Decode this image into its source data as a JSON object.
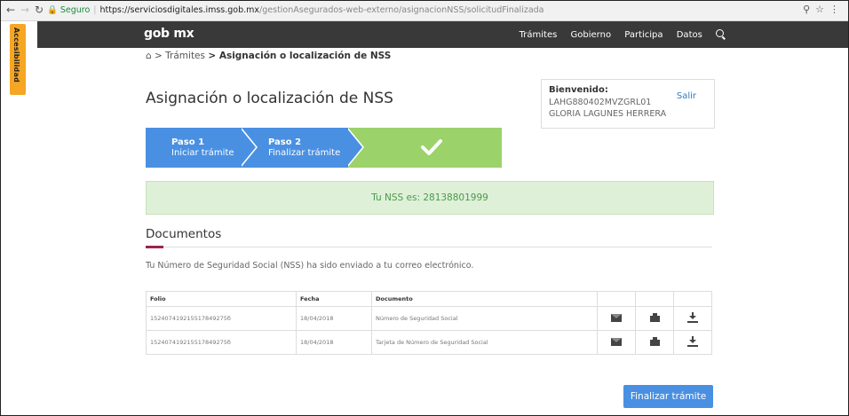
{
  "browser": {
    "secure_label": "Seguro",
    "url_host": "https://serviciosdigitales.imss.gob.mx",
    "url_path": "/gestionAsegurados-web-externo/asignacionNSS/solicitudFinalizada"
  },
  "accessibility": {
    "label": "Accesibilidad"
  },
  "header": {
    "logo": "gob mx",
    "nav": [
      "Trámites",
      "Gobierno",
      "Participa",
      "Datos"
    ]
  },
  "breadcrumb": {
    "separator": ">",
    "parent": "Trámites",
    "current": "Asignación o localización de NSS"
  },
  "page": {
    "title": "Asignación o localización de NSS"
  },
  "welcome": {
    "title": "Bienvenido:",
    "curp": "LAHG880402MVZGRL01",
    "name": "GLORIA LAGUNES HERRERA",
    "logout": "Salir"
  },
  "steps": [
    {
      "title": "Paso 1",
      "subtitle": "Iniciar trámite"
    },
    {
      "title": "Paso 2",
      "subtitle": "Finalizar trámite"
    }
  ],
  "alert": {
    "text": "Tu NSS es: 28138801999"
  },
  "documents": {
    "title": "Documentos",
    "message": "Tu Número de Seguridad Social (NSS) ha sido enviado a tu correo electrónico.",
    "columns": [
      "Folio",
      "Fecha",
      "Documento"
    ],
    "rows": [
      {
        "folio": "152407419215517849275б",
        "fecha": "18/04/2018",
        "documento": "Número de Seguridad Social"
      },
      {
        "folio": "152407419215517849275б",
        "fecha": "18/04/2018",
        "documento": "Tarjeta de Número de Seguridad Social"
      }
    ]
  },
  "actions": {
    "finish": "Finalizar trámite"
  },
  "colors": {
    "primary": "#4a90e2",
    "success_step": "#9bd26a",
    "header": "#393939",
    "accent": "#9d2449"
  }
}
